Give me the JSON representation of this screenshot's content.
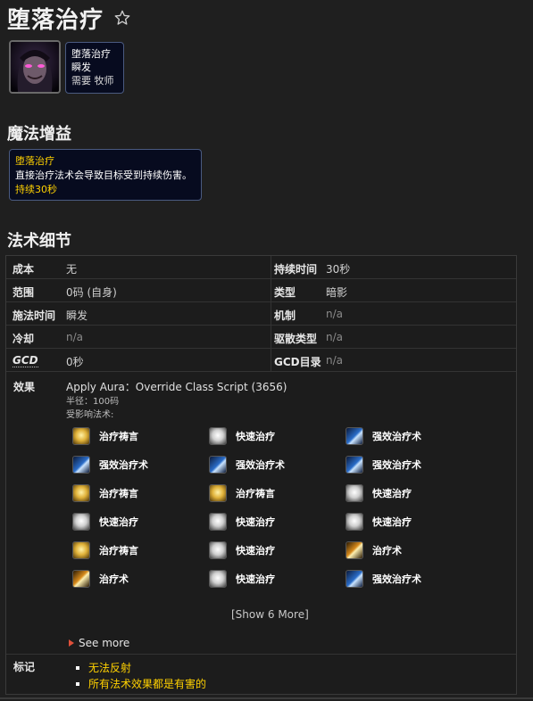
{
  "title": "堕落治疗",
  "favorite_icon": "star-outline-icon",
  "spell_tooltip": {
    "name": "堕落治疗",
    "cast": "瞬发",
    "requirement": "需要 牧师"
  },
  "buff_section": {
    "heading": "魔法增益",
    "name": "堕落治疗",
    "description": "直接治疗法术会导致目标受到持续伤害。",
    "duration": "持续30秒"
  },
  "details_section": {
    "heading": "法术细节",
    "rows": [
      {
        "l_label": "成本",
        "l_value": "无",
        "r_label": "持续时间",
        "r_value": "30秒"
      },
      {
        "l_label": "范围",
        "l_value": "0码 (自身)",
        "r_label": "类型",
        "r_value": "暗影"
      },
      {
        "l_label": "施法时间",
        "l_value": "瞬发",
        "r_label": "机制",
        "r_value": "n/a"
      },
      {
        "l_label": "冷却",
        "l_value": "n/a",
        "r_label": "驱散类型",
        "r_value": "n/a"
      },
      {
        "l_label": "GCD",
        "l_value": "0秒",
        "r_label": "GCD目录",
        "r_value": "n/a"
      }
    ],
    "effect": {
      "label": "效果",
      "main": "Apply Aura：Override Class Script (3656)",
      "radius": "半径：100码",
      "affected": "受影响法术:"
    },
    "affected_spells": [
      {
        "name": "治疗祷言",
        "icon": "prayer-of-healing-icon",
        "color": "a"
      },
      {
        "name": "快速治疗",
        "icon": "flash-heal-icon",
        "color": "b"
      },
      {
        "name": "强效治疗术",
        "icon": "greater-heal-icon",
        "color": "c"
      },
      {
        "name": "强效治疗术",
        "icon": "greater-heal-icon",
        "color": "c"
      },
      {
        "name": "强效治疗术",
        "icon": "greater-heal-icon",
        "color": "c"
      },
      {
        "name": "强效治疗术",
        "icon": "greater-heal-icon",
        "color": "c"
      },
      {
        "name": "治疗祷言",
        "icon": "prayer-of-healing-icon",
        "color": "a"
      },
      {
        "name": "治疗祷言",
        "icon": "prayer-of-healing-icon",
        "color": "a"
      },
      {
        "name": "快速治疗",
        "icon": "flash-heal-icon",
        "color": "b"
      },
      {
        "name": "快速治疗",
        "icon": "flash-heal-icon",
        "color": "b"
      },
      {
        "name": "快速治疗",
        "icon": "flash-heal-icon",
        "color": "b"
      },
      {
        "name": "快速治疗",
        "icon": "flash-heal-icon",
        "color": "b"
      },
      {
        "name": "治疗祷言",
        "icon": "prayer-of-healing-icon",
        "color": "a"
      },
      {
        "name": "快速治疗",
        "icon": "flash-heal-icon",
        "color": "b"
      },
      {
        "name": "治疗术",
        "icon": "heal-icon",
        "color": "d"
      },
      {
        "name": "治疗术",
        "icon": "heal-icon",
        "color": "d"
      },
      {
        "name": "快速治疗",
        "icon": "flash-heal-icon",
        "color": "b"
      },
      {
        "name": "强效治疗术",
        "icon": "greater-heal-icon",
        "color": "c"
      }
    ],
    "show_more": "[Show 6 More]",
    "see_more": "See more",
    "flags_label": "标记",
    "flags": [
      "无法反射",
      "所有法术效果都是有害的"
    ]
  },
  "colors": {
    "background": "#1f1f1f",
    "tooltip_bg": "#070b1f",
    "highlight_yellow": "#ffd100"
  }
}
